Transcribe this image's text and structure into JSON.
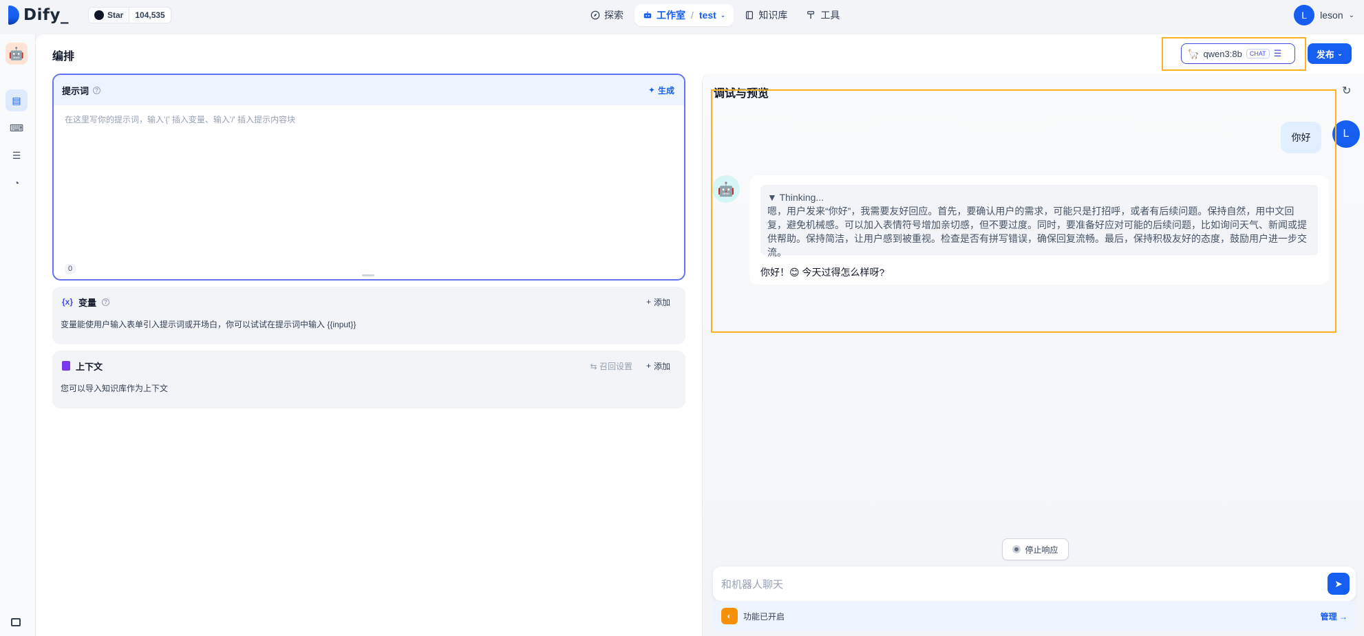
{
  "brand": {
    "name": "Dify",
    "accent_color": "#155eef"
  },
  "github": {
    "star_label": "Star",
    "star_count": "104,535"
  },
  "nav": {
    "explore": "探索",
    "studio": "工作室",
    "app": "test",
    "knowledge": "知识库",
    "tools": "工具"
  },
  "user": {
    "initial": "L",
    "name": "leson"
  },
  "page": {
    "title": "编排"
  },
  "model": {
    "name": "qwen3:8b",
    "mode": "CHAT"
  },
  "publish": {
    "label": "发布"
  },
  "prompt": {
    "title": "提示词",
    "generate": "生成",
    "placeholder": "在这里写你的提示词，输入'{' 插入变量、输入'/' 插入提示内容块",
    "count": "0"
  },
  "variables": {
    "title": "变量",
    "add": "添加",
    "desc": "变量能使用户输入表单引入提示词或开场白，你可以试试在提示词中输入 {{input}}"
  },
  "context": {
    "title": "上下文",
    "recall": "召回设置",
    "add": "添加",
    "desc": "您可以导入知识库作为上下文"
  },
  "debug": {
    "title": "调试与预览",
    "user_msg": "你好",
    "thinking_title": "▼ Thinking...",
    "thinking_text": "嗯，用户发来“你好”，我需要友好回应。首先，要确认用户的需求，可能只是打招呼，或者有后续问题。保持自然，用中文回复，避免机械感。可以加入表情符号增加亲切感，但不要过度。同时，要准备好应对可能的后续问题，比如询问天气、新闻或提供帮助。保持简洁，让用户感到被重视。检查是否有拼写错误，确保回复流畅。最后，保持积极友好的态度，鼓励用户进一步交流。",
    "answer": "你好！😊 今天过得怎么样呀?",
    "stop": "停止响应",
    "input_placeholder": "和机器人聊天",
    "features": "功能已开启",
    "manage": "管理"
  }
}
